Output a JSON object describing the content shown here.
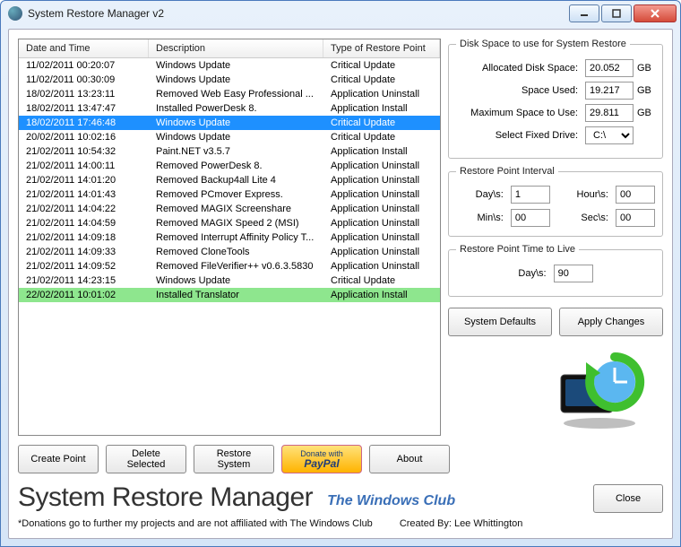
{
  "window": {
    "title": "System Restore Manager v2"
  },
  "table": {
    "headers": {
      "date": "Date and Time",
      "desc": "Description",
      "type": "Type of Restore Point"
    },
    "rows": [
      {
        "date": "11/02/2011 00:20:07",
        "desc": "Windows Update",
        "type": "Critical Update",
        "sel": false
      },
      {
        "date": "11/02/2011 00:30:09",
        "desc": "Windows Update",
        "type": "Critical Update",
        "sel": false
      },
      {
        "date": "18/02/2011 13:23:11",
        "desc": "Removed Web Easy Professional ...",
        "type": "Application Uninstall",
        "sel": false
      },
      {
        "date": "18/02/2011 13:47:47",
        "desc": "Installed PowerDesk 8.",
        "type": "Application Install",
        "sel": false
      },
      {
        "date": "18/02/2011 17:46:48",
        "desc": "Windows Update",
        "type": "Critical Update",
        "sel": true
      },
      {
        "date": "20/02/2011 10:02:16",
        "desc": "Windows Update",
        "type": "Critical Update",
        "sel": false
      },
      {
        "date": "21/02/2011 10:54:32",
        "desc": "Paint.NET v3.5.7",
        "type": "Application Install",
        "sel": false
      },
      {
        "date": "21/02/2011 14:00:11",
        "desc": "Removed PowerDesk 8.",
        "type": "Application Uninstall",
        "sel": false
      },
      {
        "date": "21/02/2011 14:01:20",
        "desc": "Removed Backup4all Lite 4",
        "type": "Application Uninstall",
        "sel": false
      },
      {
        "date": "21/02/2011 14:01:43",
        "desc": "Removed PCmover Express.",
        "type": "Application Uninstall",
        "sel": false
      },
      {
        "date": "21/02/2011 14:04:22",
        "desc": "Removed MAGIX Screenshare",
        "type": "Application Uninstall",
        "sel": false
      },
      {
        "date": "21/02/2011 14:04:59",
        "desc": "Removed MAGIX Speed 2 (MSI)",
        "type": "Application Uninstall",
        "sel": false
      },
      {
        "date": "21/02/2011 14:09:18",
        "desc": "Removed Interrupt Affinity Policy T...",
        "type": "Application Uninstall",
        "sel": false
      },
      {
        "date": "21/02/2011 14:09:33",
        "desc": "Removed CloneTools",
        "type": "Application Uninstall",
        "sel": false
      },
      {
        "date": "21/02/2011 14:09:52",
        "desc": "Removed FileVerifier++ v0.6.3.5830",
        "type": "Application Uninstall",
        "sel": false
      },
      {
        "date": "21/02/2011 14:23:15",
        "desc": "Windows Update",
        "type": "Critical Update",
        "sel": false
      },
      {
        "date": "22/02/2011 10:01:02",
        "desc": "Installed Translator",
        "type": "Application Install",
        "sel": false,
        "green": true
      }
    ]
  },
  "diskSpace": {
    "legend": "Disk Space to use for System Restore",
    "allocLabel": "Allocated Disk Space:",
    "alloc": "20.052",
    "usedLabel": "Space Used:",
    "used": "19.217",
    "maxLabel": "Maximum Space to Use:",
    "max": "29.811",
    "unit": "GB",
    "driveLabel": "Select Fixed Drive:",
    "drive": "C:\\"
  },
  "interval": {
    "legend": "Restore Point Interval",
    "daysLabel": "Day\\s:",
    "days": "1",
    "hoursLabel": "Hour\\s:",
    "hours": "00",
    "minsLabel": "Min\\s:",
    "mins": "00",
    "secsLabel": "Sec\\s:",
    "secs": "00"
  },
  "ttl": {
    "legend": "Restore Point Time to Live",
    "daysLabel": "Day\\s:",
    "days": "90"
  },
  "buttons": {
    "defaults": "System Defaults",
    "apply": "Apply Changes",
    "create": "Create Point",
    "delete": "Delete Selected",
    "restore": "Restore System",
    "donateTop": "Donate with",
    "donateBrand": "PayPal",
    "about": "About",
    "close": "Close"
  },
  "footer": {
    "appName": "System Restore Manager",
    "subBrand": "The Windows Club",
    "donationNote": "*Donations go to further my projects and are not affiliated with The Windows Club",
    "createdBy": "Created By: Lee Whittington"
  }
}
